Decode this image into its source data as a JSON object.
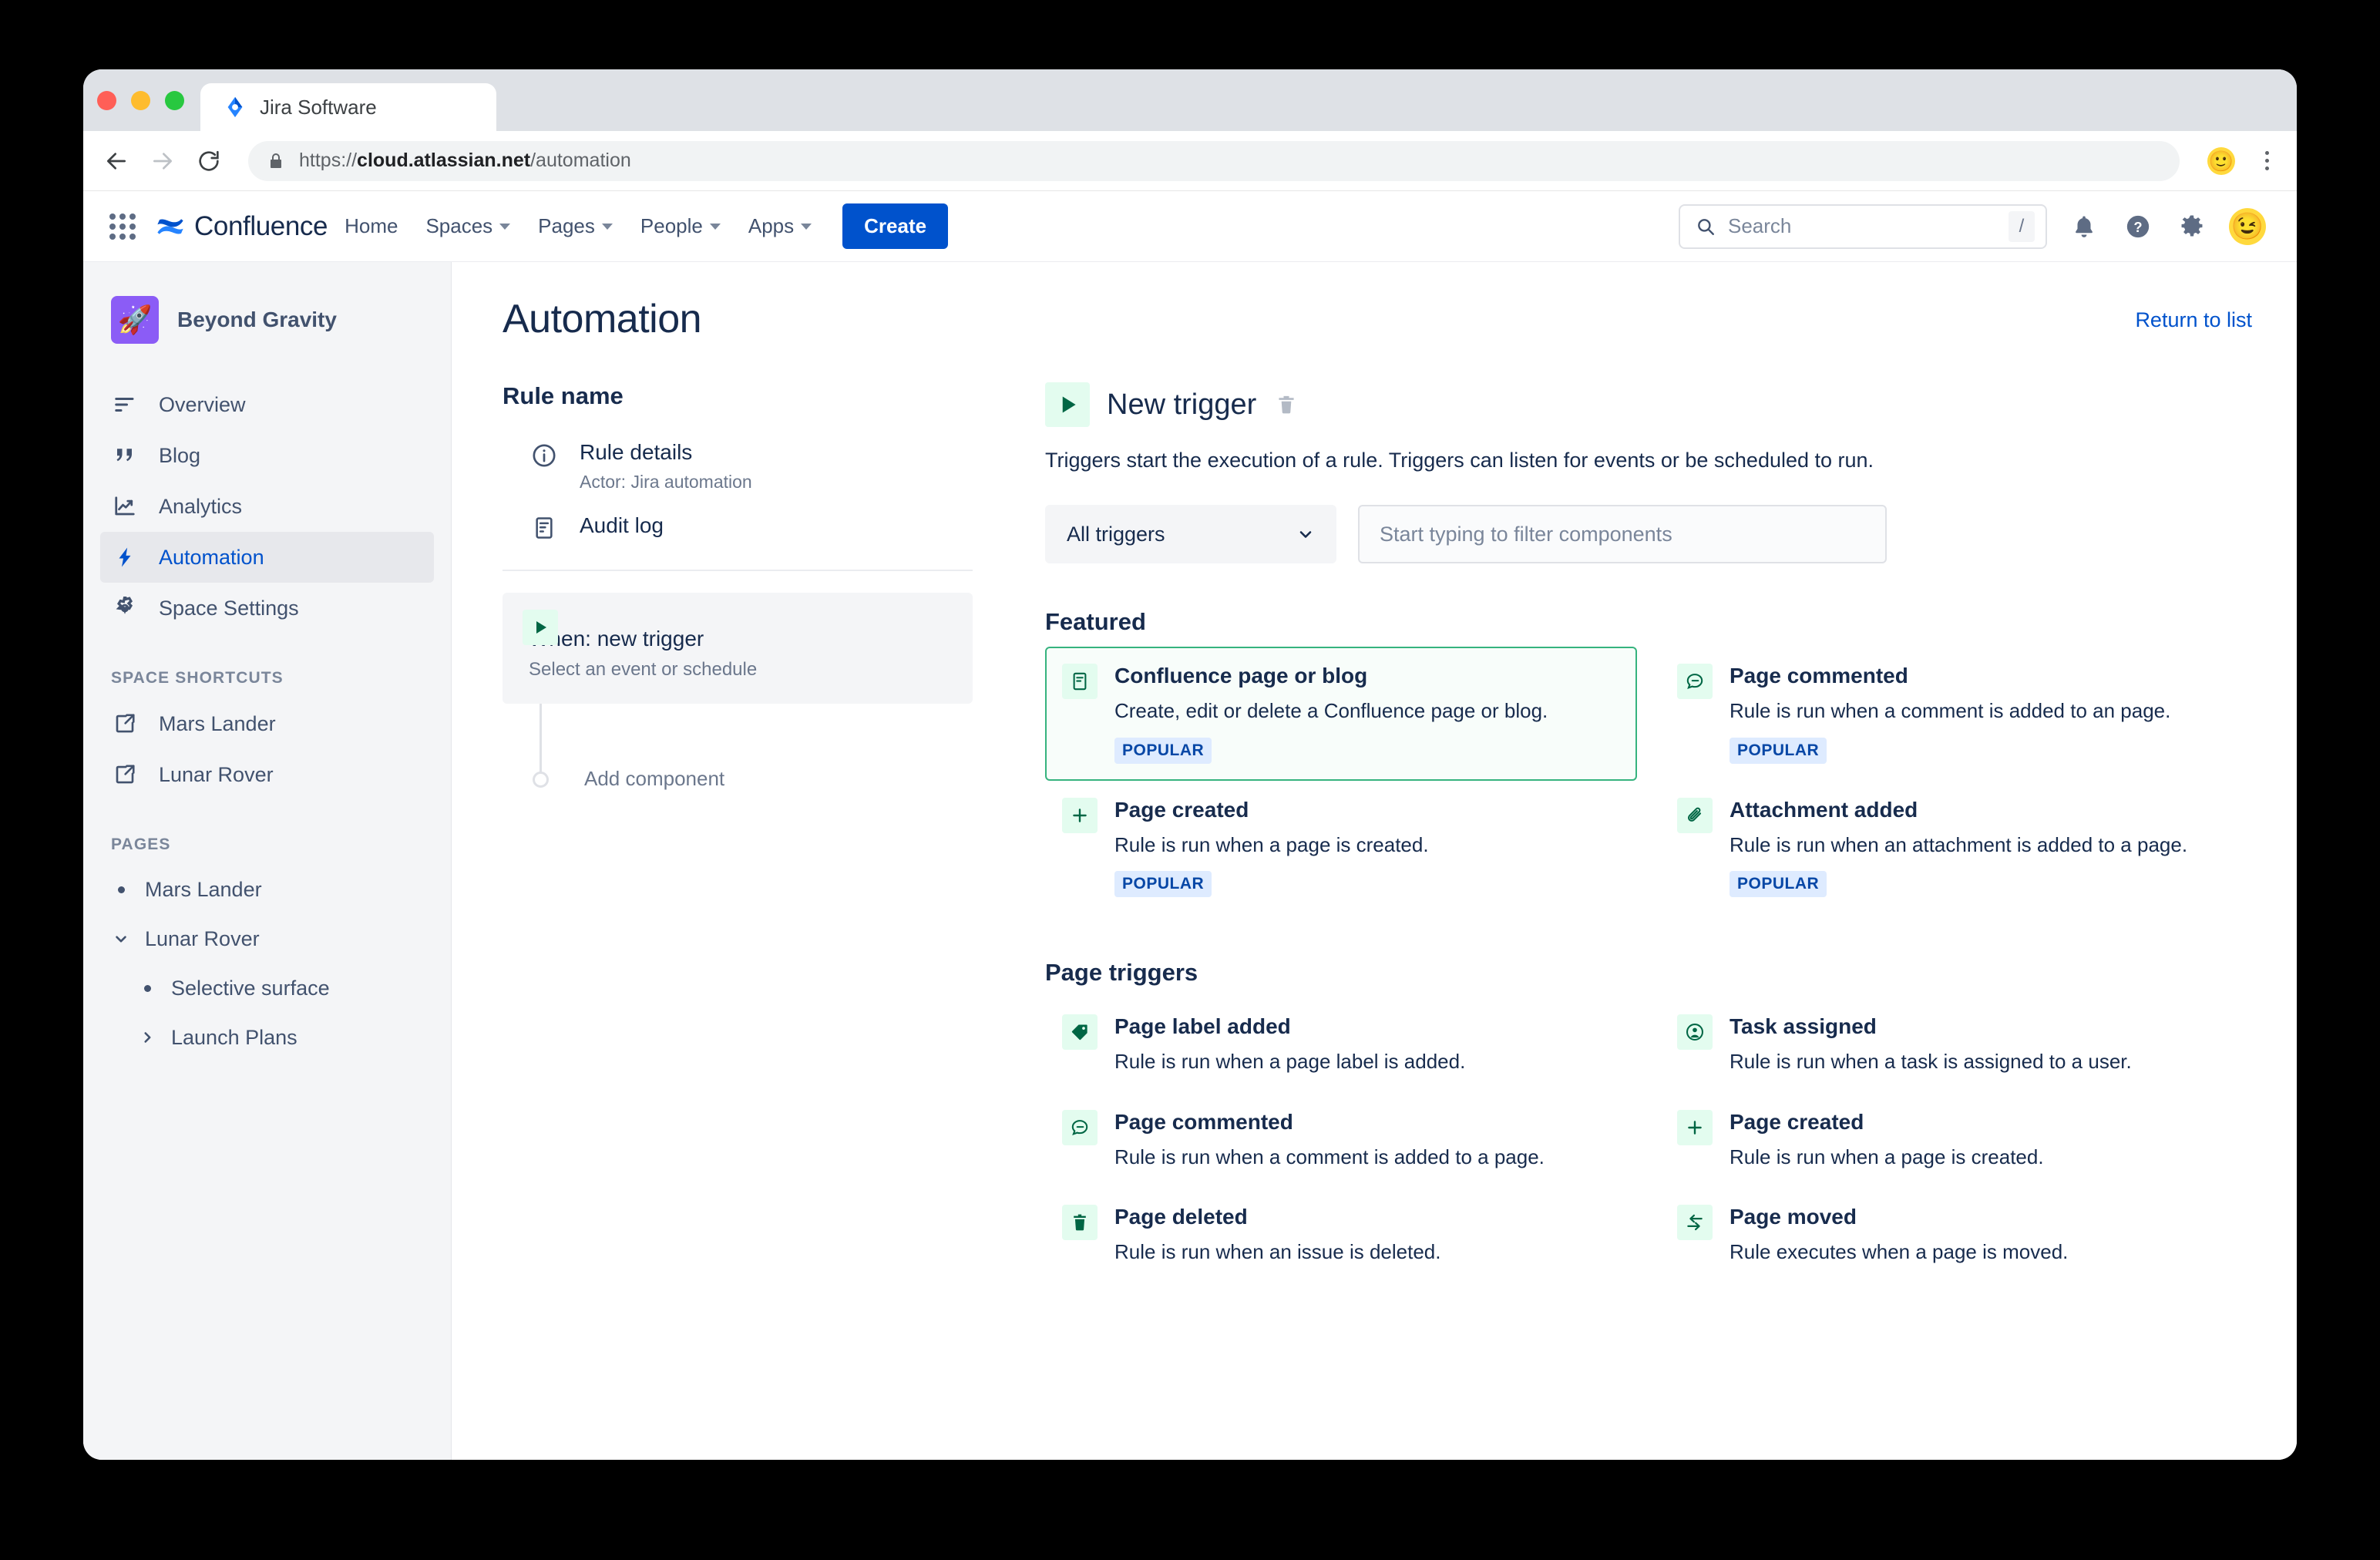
{
  "browser": {
    "tab_title": "Jira Software",
    "url_prefix": "https://",
    "url_domain": "cloud.atlassian.net",
    "url_path": "/automation",
    "back_icon": "back-arrow-icon",
    "forward_icon": "forward-arrow-icon",
    "reload_icon": "reload-icon",
    "lock_icon": "lock-icon"
  },
  "topnav": {
    "app_switcher": "app-switcher-icon",
    "brand": "Confluence",
    "items": [
      {
        "label": "Home",
        "has_caret": false
      },
      {
        "label": "Spaces",
        "has_caret": true
      },
      {
        "label": "Pages",
        "has_caret": true
      },
      {
        "label": "People",
        "has_caret": true
      },
      {
        "label": "Apps",
        "has_caret": true
      }
    ],
    "create_label": "Create",
    "search_placeholder": "Search",
    "search_shortcut": "/",
    "notifications_icon": "bell-icon",
    "help_icon": "help-icon",
    "settings_icon": "gear-icon",
    "avatar_icon": "user-avatar"
  },
  "sidebar": {
    "space_name": "Beyond Gravity",
    "space_emoji": "🚀",
    "items": [
      {
        "label": "Overview",
        "icon": "overview-icon",
        "active": false
      },
      {
        "label": "Blog",
        "icon": "quote-icon",
        "active": false
      },
      {
        "label": "Analytics",
        "icon": "analytics-icon",
        "active": false
      },
      {
        "label": "Automation",
        "icon": "lightning-icon",
        "active": true
      },
      {
        "label": "Space Settings",
        "icon": "gear-icon",
        "active": false
      }
    ],
    "shortcuts_title": "SPACE SHORTCUTS",
    "shortcuts": [
      {
        "label": "Mars Lander",
        "icon": "external-link-icon"
      },
      {
        "label": "Lunar Rover",
        "icon": "external-link-icon"
      }
    ],
    "pages_title": "PAGES",
    "pages": [
      {
        "label": "Mars Lander",
        "marker": "bullet",
        "indent": false
      },
      {
        "label": "Lunar Rover",
        "marker": "chevron-down",
        "indent": false
      },
      {
        "label": "Selective surface",
        "marker": "bullet",
        "indent": true
      },
      {
        "label": "Launch Plans",
        "marker": "chevron-right",
        "indent": true
      }
    ]
  },
  "content": {
    "page_title": "Automation",
    "return_to_list": "Return to list"
  },
  "rule": {
    "rule_name_label": "Rule name",
    "details_title": "Rule details",
    "details_sub": "Actor: Jira automation",
    "audit_log_title": "Audit log",
    "trigger_title": "When: new trigger",
    "trigger_sub": "Select an event or schedule",
    "add_component": "Add component"
  },
  "picker": {
    "title": "New trigger",
    "trash_icon": "trash-icon",
    "description": "Triggers start the execution of a rule. Triggers can listen for events or be scheduled to run.",
    "select_value": "All triggers",
    "filter_placeholder": "Start typing to filter components",
    "sections": [
      {
        "title": "Featured",
        "items": [
          {
            "title": "Confluence page or blog",
            "desc": "Create, edit or delete a Confluence page or blog.",
            "badge": "POPULAR",
            "icon": "page-icon",
            "selected": true
          },
          {
            "title": "Page commented",
            "desc": "Rule is run when a comment is added to an page.",
            "badge": "POPULAR",
            "icon": "comment-icon",
            "selected": false
          },
          {
            "title": "Page created",
            "desc": "Rule is run when a page is created.",
            "badge": "POPULAR",
            "icon": "plus-icon",
            "selected": false
          },
          {
            "title": "Attachment added",
            "desc": "Rule is run when an attachment is added to a page.",
            "badge": "POPULAR",
            "icon": "paperclip-icon",
            "selected": false
          }
        ]
      },
      {
        "title": "Page triggers",
        "items": [
          {
            "title": "Page label added",
            "desc": "Rule is run when a page label is added.",
            "badge": "",
            "icon": "label-icon",
            "selected": false
          },
          {
            "title": "Task assigned",
            "desc": "Rule is run when a task is assigned to a user.",
            "badge": "",
            "icon": "person-icon",
            "selected": false
          },
          {
            "title": "Page commented",
            "desc": "Rule is run when a comment is added to a page.",
            "badge": "",
            "icon": "comment-icon",
            "selected": false
          },
          {
            "title": "Page created",
            "desc": "Rule is run when a page is created.",
            "badge": "",
            "icon": "plus-icon",
            "selected": false
          },
          {
            "title": "Page deleted",
            "desc": "Rule is run when an issue is deleted.",
            "badge": "",
            "icon": "trash-icon",
            "selected": false
          },
          {
            "title": "Page moved",
            "desc": "Rule executes when a page is moved.",
            "badge": "",
            "icon": "move-icon",
            "selected": false
          }
        ]
      }
    ]
  },
  "colors": {
    "brand_blue": "#0052cc",
    "green": "#006644",
    "green_bg": "#e3fcef",
    "text": "#172b4d",
    "subtle": "#6b778c"
  }
}
